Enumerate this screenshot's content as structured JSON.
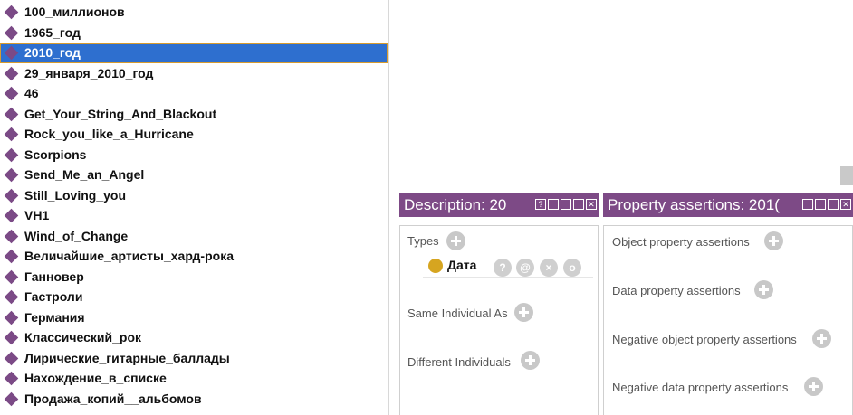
{
  "individuals": [
    {
      "label": "100_миллионов",
      "selected": false
    },
    {
      "label": "1965_год",
      "selected": false
    },
    {
      "label": "2010_год",
      "selected": true
    },
    {
      "label": "29_января_2010_год",
      "selected": false
    },
    {
      "label": "46",
      "selected": false
    },
    {
      "label": "Get_Your_String_And_Blackout",
      "selected": false
    },
    {
      "label": "Rock_you_like_a_Hurricane",
      "selected": false
    },
    {
      "label": "Scorpions",
      "selected": false
    },
    {
      "label": "Send_Me_an_Angel",
      "selected": false
    },
    {
      "label": "Still_Loving_you",
      "selected": false
    },
    {
      "label": "VH1",
      "selected": false
    },
    {
      "label": "Wind_of_Change",
      "selected": false
    },
    {
      "label": "Величайшие_артисты_хард-рока",
      "selected": false
    },
    {
      "label": "Ганновер",
      "selected": false
    },
    {
      "label": "Гастроли",
      "selected": false
    },
    {
      "label": "Германия",
      "selected": false
    },
    {
      "label": "Классический_рок",
      "selected": false
    },
    {
      "label": "Лирические_гитарные_баллады",
      "selected": false
    },
    {
      "label": "Нахождение_в_списке",
      "selected": false
    },
    {
      "label": "Продажа_копий__альбомов",
      "selected": false
    }
  ],
  "description_panel": {
    "title": "Description: 20",
    "types_label": "Types",
    "type_value": "Дата",
    "same_individual_label": "Same Individual As",
    "different_individuals_label": "Different Individuals"
  },
  "property_panel": {
    "title": "Property assertions: 201(",
    "object_label": "Object property assertions",
    "data_label": "Data property assertions",
    "neg_object_label": "Negative object property assertions",
    "neg_data_label": "Negative data property assertions"
  },
  "panel_buttons": [
    "?",
    "▯▯",
    "▭",
    "■",
    "✕"
  ],
  "type_icons": [
    "?",
    "@",
    "×",
    "o"
  ],
  "colors": {
    "panel_header": "#7d4a86",
    "individual_icon": "#7b4a86",
    "selection": "#2e6fcf",
    "class_icon": "#d6a520"
  }
}
